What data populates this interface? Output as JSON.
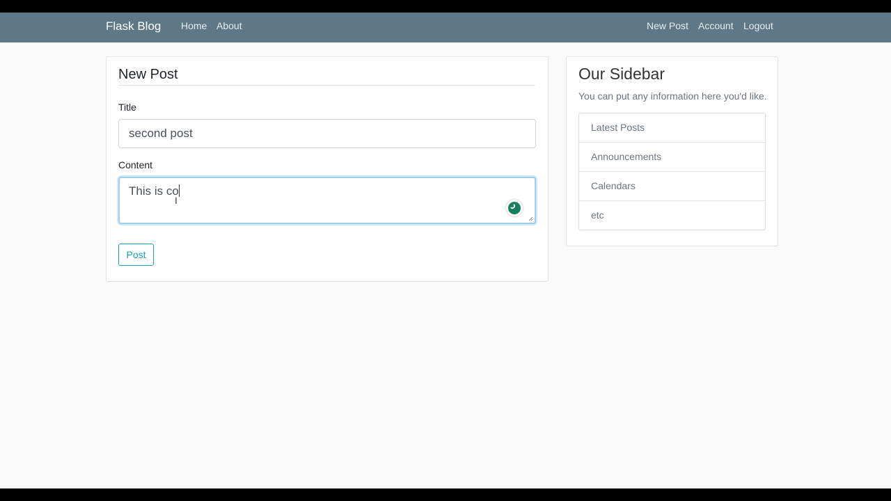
{
  "nav": {
    "brand": "Flask Blog",
    "left_links": [
      "Home",
      "About"
    ],
    "right_links": [
      "New Post",
      "Account",
      "Logout"
    ]
  },
  "form": {
    "legend": "New Post",
    "title_label": "Title",
    "title_value": "second post",
    "content_label": "Content",
    "content_value": "This is co",
    "submit_label": "Post"
  },
  "sidebar": {
    "title": "Our Sidebar",
    "description": "You can put any information here you'd like.",
    "items": [
      "Latest Posts",
      "Announcements",
      "Calendars",
      "etc"
    ]
  },
  "colors": {
    "navbar": "#5f7886",
    "accent": "#17a2b8",
    "grammar_icon": "#15805f"
  }
}
